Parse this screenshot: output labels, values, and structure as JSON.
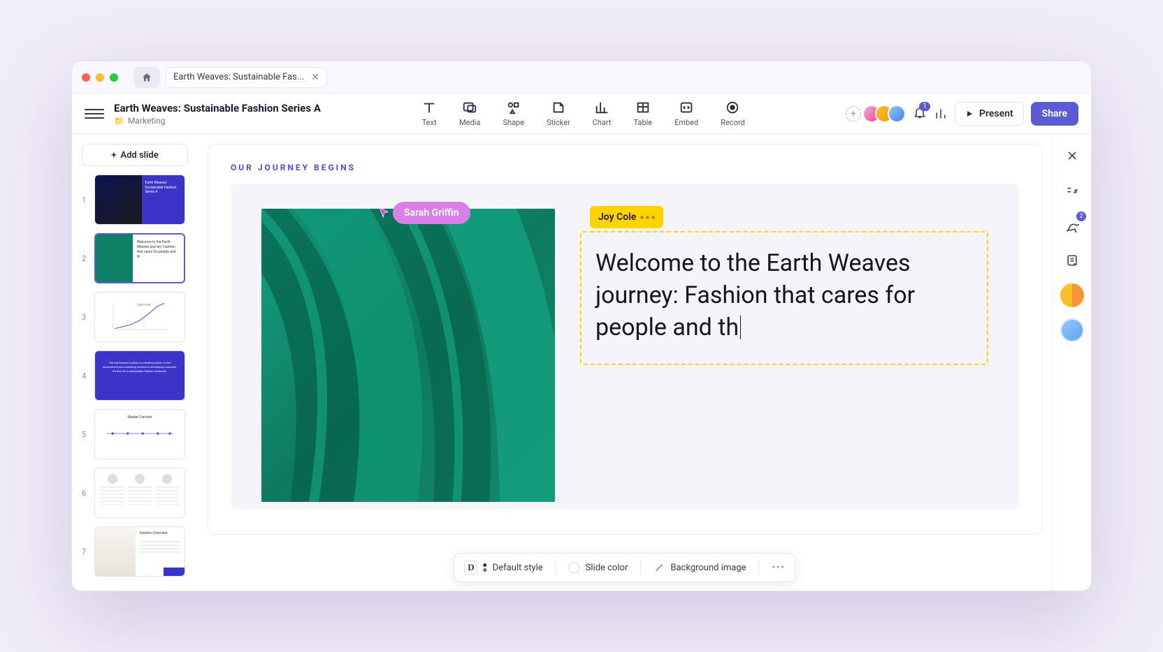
{
  "tab_title": "Earth Weaves: Sustainable Fas...",
  "doc": {
    "title": "Earth Weaves: Sustainable Fashion Series A",
    "folder": "Marketing"
  },
  "tools": {
    "text": "Text",
    "media": "Media",
    "shape": "Shape",
    "sticker": "Sticker",
    "chart": "Chart",
    "table": "Table",
    "embed": "Embed",
    "record": "Record"
  },
  "top_right": {
    "notifications_count": "1",
    "present": "Present",
    "share": "Share"
  },
  "sidebar": {
    "add_slide": "Add slide",
    "slides": [
      {
        "num": "1",
        "title_line1": "Earth Weaves:",
        "title_line2": "Sustainable Fashion",
        "title_line3": "Series A"
      },
      {
        "num": "2",
        "preview": "Welcome to the Earth Weaves journey: Fashion that cares for people and th"
      },
      {
        "num": "3"
      },
      {
        "num": "4",
        "text": "The fast fashion industry is wreaking havoc on the environment and exploiting workers in developing countries. It's time for a sustainable fashion revolution."
      },
      {
        "num": "5",
        "title": "Market Traction"
      },
      {
        "num": "6"
      },
      {
        "num": "7",
        "title": "Solution Overview"
      }
    ]
  },
  "canvas": {
    "eyebrow": "OUR JOURNEY BEGINS",
    "cursor_user": "Sarah Griffin",
    "editing_user": "Joy Cole",
    "body_text": "Welcome to the Earth Weaves journey: Fashion that cares for people and th"
  },
  "bottom_bar": {
    "default_style": "Default style",
    "slide_color": "Slide color",
    "background_image": "Background image"
  },
  "right_rail": {
    "comments_count": "2"
  }
}
